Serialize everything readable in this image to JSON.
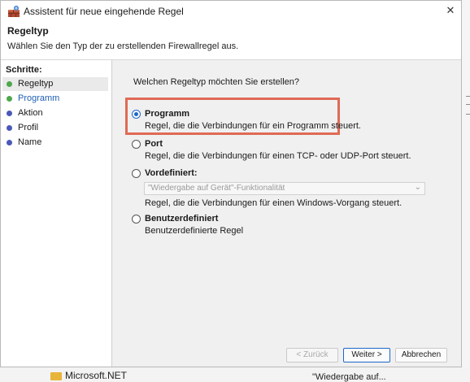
{
  "window": {
    "title": "Assistent für neue eingehende Regel",
    "close_glyph": "✕"
  },
  "header": {
    "title": "Regeltyp",
    "subtitle": "Wählen Sie den Typ der zu erstellenden Firewallregel aus."
  },
  "sidebar": {
    "steps_label": "Schritte:",
    "items": [
      {
        "label": "Regeltyp",
        "status": "green",
        "active": true
      },
      {
        "label": "Programm",
        "status": "green",
        "active": false
      },
      {
        "label": "Aktion",
        "status": "blue",
        "active": false
      },
      {
        "label": "Profil",
        "status": "blue",
        "active": false
      },
      {
        "label": "Name",
        "status": "blue",
        "active": false
      }
    ]
  },
  "content": {
    "question": "Welchen Regeltyp möchten Sie erstellen?",
    "options": [
      {
        "title": "Programm",
        "description": "Regel, die die Verbindungen für ein Programm steuert.",
        "selected": true
      },
      {
        "title": "Port",
        "description": "Regel, die die Verbindungen für einen TCP- oder UDP-Port steuert.",
        "selected": false
      },
      {
        "title": "Vordefiniert:",
        "description": "Regel, die die Verbindungen für einen Windows-Vorgang steuert.",
        "selected": false
      },
      {
        "title": "Benutzerdefiniert",
        "description": "Benutzerdefinierte Regel",
        "selected": false
      }
    ],
    "predefined_select_value": "\"Wiedergabe auf Gerät\"-Funktionalität",
    "highlight_color": "#e06a55"
  },
  "buttons": {
    "back": "< Zurück",
    "next": "Weiter >",
    "cancel": "Abbrechen"
  },
  "background": {
    "folder_label": "Microsoft.NET",
    "right_label": "\"Wiedergabe auf..."
  }
}
